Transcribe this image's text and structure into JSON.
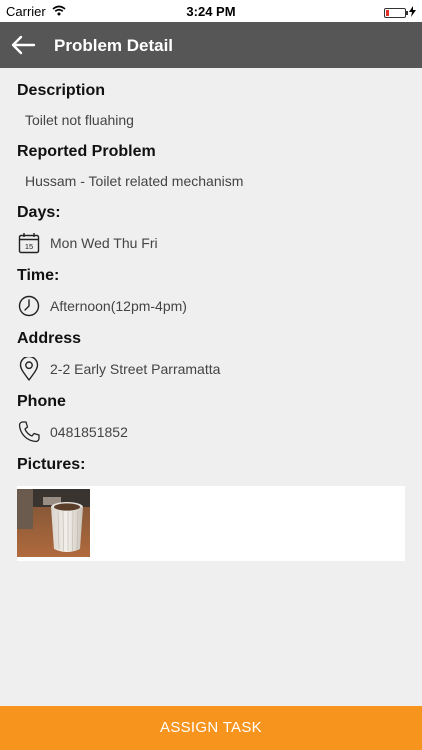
{
  "status_bar": {
    "carrier": "Carrier",
    "time": "3:24 PM"
  },
  "nav": {
    "title": "Problem Detail",
    "back_icon": "arrow-left-icon"
  },
  "description": {
    "label": "Description",
    "value": "Toilet not fluahing"
  },
  "reported_problem": {
    "label": "Reported Problem",
    "value": "Hussam - Toilet related mechanism"
  },
  "days": {
    "label": "Days:",
    "icon_day": "15",
    "value": "Mon Wed Thu Fri"
  },
  "time": {
    "label": "Time:",
    "value": "Afternoon(12pm-4pm)"
  },
  "address": {
    "label": "Address",
    "value": "2-2 Early Street Parramatta"
  },
  "phone": {
    "label": "Phone",
    "value": "0481851852"
  },
  "pictures": {
    "label": "Pictures:"
  },
  "actions": {
    "assign_task": "ASSIGN TASK"
  },
  "colors": {
    "accent": "#f7941d",
    "nav_background": "#565656",
    "page_background": "#efefef"
  }
}
